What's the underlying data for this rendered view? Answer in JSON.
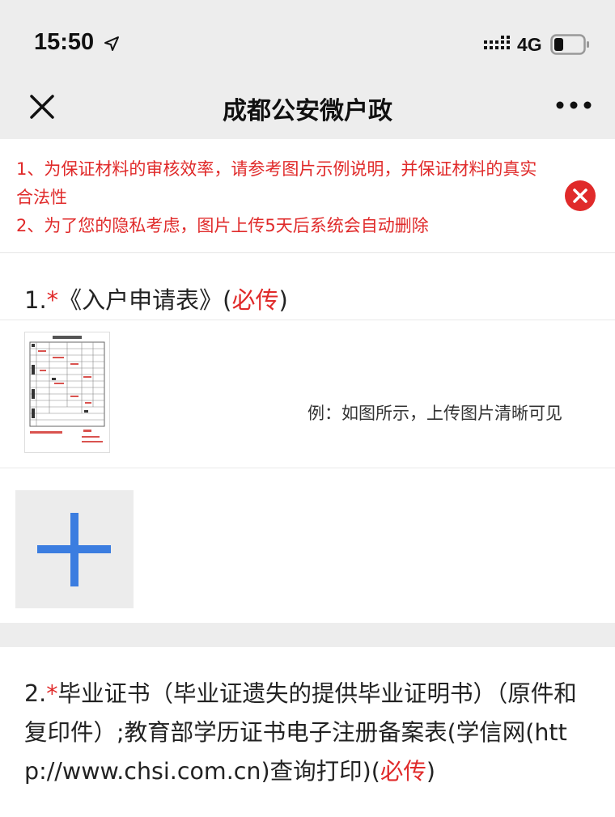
{
  "status_bar": {
    "time": "15:50",
    "network": "4G"
  },
  "nav": {
    "title": "成都公安微户政",
    "close_icon": "close-icon",
    "more_icon": "more-icon"
  },
  "notice": {
    "line1": "1、为保证材料的审核效率，请参考图片示例说明，并保证材料的真实合法性",
    "line2": "2、为了您的隐私考虑，图片上传5天后系统会自动删除",
    "close_icon": "close-circle-icon"
  },
  "section1": {
    "num": "1.",
    "star": "*",
    "name": "《入户申请表》(",
    "required": "必传",
    "close_paren": ")",
    "example_text": "例：如图所示，上传图片清晰可见",
    "upload_icon": "plus-icon"
  },
  "section2": {
    "num": "2.",
    "star": "*",
    "name": "毕业证书（毕业证遗失的提供毕业证明书）（原件和复印件）;教育部学历证书电子注册备案表(学信网(http://www.chsi.com.cn)查询打印)(",
    "required": "必传",
    "close_paren": ")"
  },
  "colors": {
    "accent_red": "#e02a2a",
    "plus_blue": "#3b7de0",
    "bar_gray": "#ededed"
  }
}
